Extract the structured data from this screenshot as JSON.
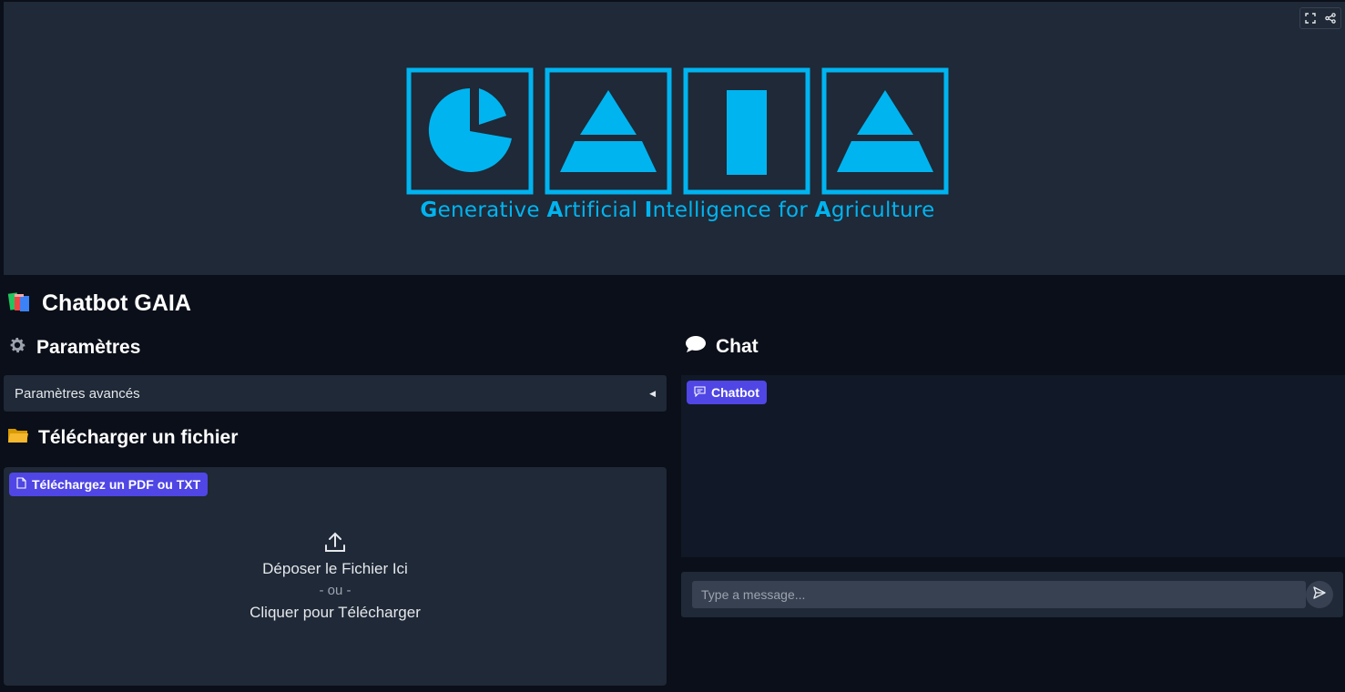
{
  "banner": {
    "logo_letters": "GAIA",
    "caption_parts": [
      {
        "cap": "G",
        "rest": "enerative "
      },
      {
        "cap": "A",
        "rest": "rtificial "
      },
      {
        "cap": "I",
        "rest": "ntelligence for "
      },
      {
        "cap": "A",
        "rest": "griculture"
      }
    ],
    "logo_color": "#00b4f0",
    "tools": [
      "fullscreen-icon",
      "share-icon"
    ]
  },
  "app": {
    "title_icon": "books-icon",
    "title": "Chatbot GAIA"
  },
  "params": {
    "icon": "gear-icon",
    "heading": "Paramètres",
    "accordion_label": "Paramètres avancés"
  },
  "upload": {
    "icon": "folder-icon",
    "heading": "Télécharger un fichier",
    "pill_label": "Téléchargez un PDF ou TXT",
    "drop_text": "Déposer le Fichier Ici",
    "or_text": "- ou -",
    "click_text": "Cliquer pour Télécharger"
  },
  "chat": {
    "icon": "speech-bubble-icon",
    "heading": "Chat",
    "pill_label": "Chatbot",
    "input_placeholder": "Type a message..."
  },
  "colors": {
    "accent": "#4f46e5",
    "background": "#0b0f19",
    "panel": "#1f2937"
  }
}
